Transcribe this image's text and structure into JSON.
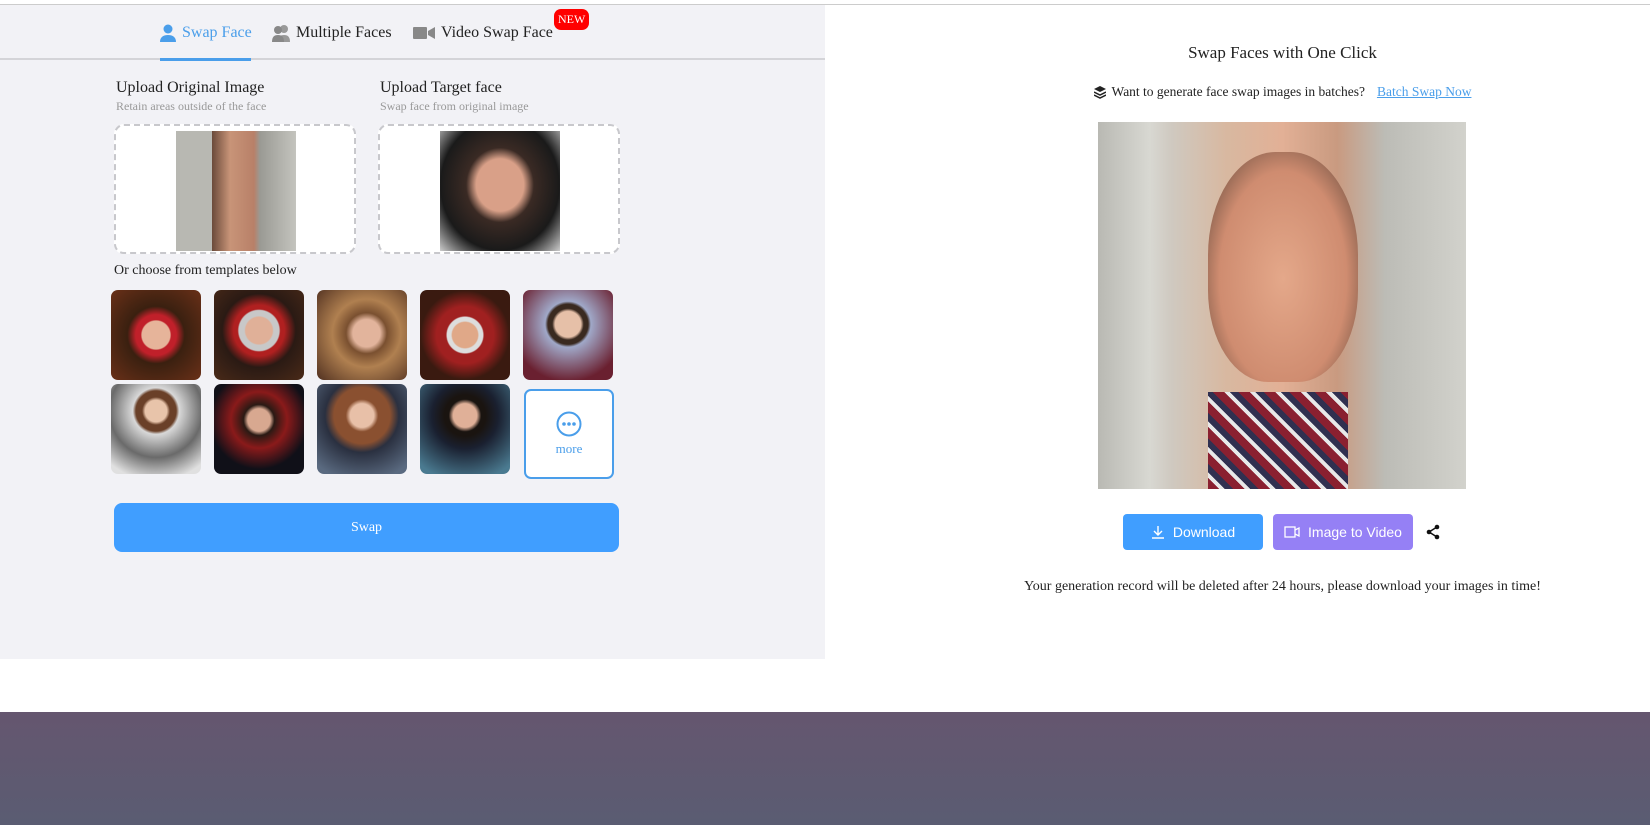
{
  "tabs": [
    {
      "label": "Swap Face",
      "icon": "user-icon",
      "active": true
    },
    {
      "label": "Multiple Faces",
      "icon": "users-icon"
    },
    {
      "label": "Video Swap Face",
      "icon": "video-icon",
      "badge": "NEW"
    }
  ],
  "upload_original": {
    "label": "Upload Original Image",
    "hint": "Retain areas outside of the face"
  },
  "upload_target": {
    "label": "Upload Target face",
    "hint": "Swap face from original image"
  },
  "templates": {
    "label": "Or choose from templates below",
    "more_label": "more"
  },
  "swap_label": "Swap",
  "result": {
    "title": "Swap Faces with One Click",
    "batch_text": "Want to generate face swap images in batches?",
    "batch_link": "Batch Swap Now",
    "download_label": "Download",
    "image_to_video_label": "Image to Video",
    "notice": "Your generation record will be deleted after 24 hours, please download your images in time!"
  },
  "colors": {
    "accent": "#409eff",
    "purple": "#9580f5",
    "badge": "#ff0000"
  }
}
